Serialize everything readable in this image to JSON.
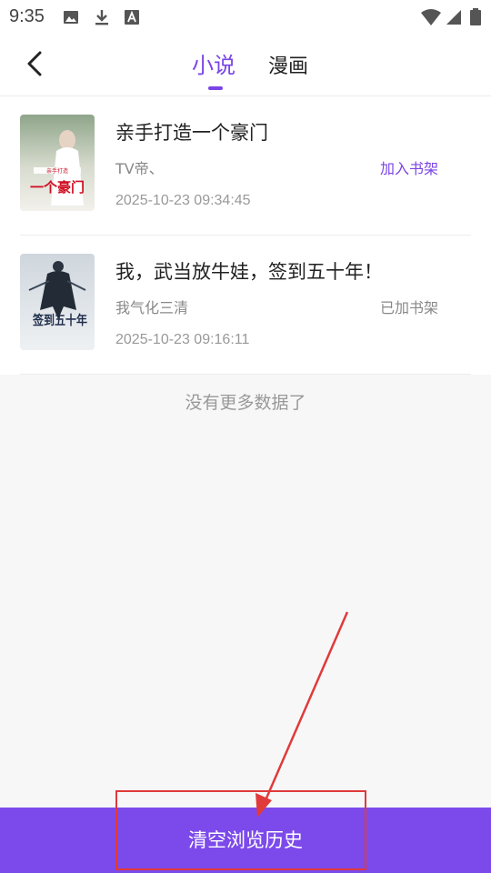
{
  "status_bar": {
    "time": "9:35",
    "icons": [
      "image-icon",
      "download-icon",
      "font-a-icon",
      "wifi-icon",
      "signal-icon",
      "battery-icon"
    ]
  },
  "header": {
    "back_icon": "chevron-left-icon",
    "tabs": [
      {
        "label": "小说",
        "active": true
      },
      {
        "label": "漫画",
        "active": false
      }
    ],
    "accent_color": "#7a45e6"
  },
  "books": [
    {
      "title": "亲手打造一个豪门",
      "author": "TV帝、",
      "action": "加入书架",
      "time": "2025-10-23 09:34:45",
      "cover_text": "一个豪门",
      "cover_top_text": "亲手打造"
    },
    {
      "title": "我，武当放牛娃，签到五十年！",
      "author": "我气化三清",
      "action": "已加书架",
      "time": "2025-10-23 09:16:11",
      "cover_text": "签到五十年",
      "cover_top_text": ""
    }
  ],
  "footer_note": "没有更多数据了",
  "clear_button": {
    "label": "清空浏览历史",
    "color": "#7c4aea"
  },
  "annotation": {
    "color": "#e03a3a"
  }
}
